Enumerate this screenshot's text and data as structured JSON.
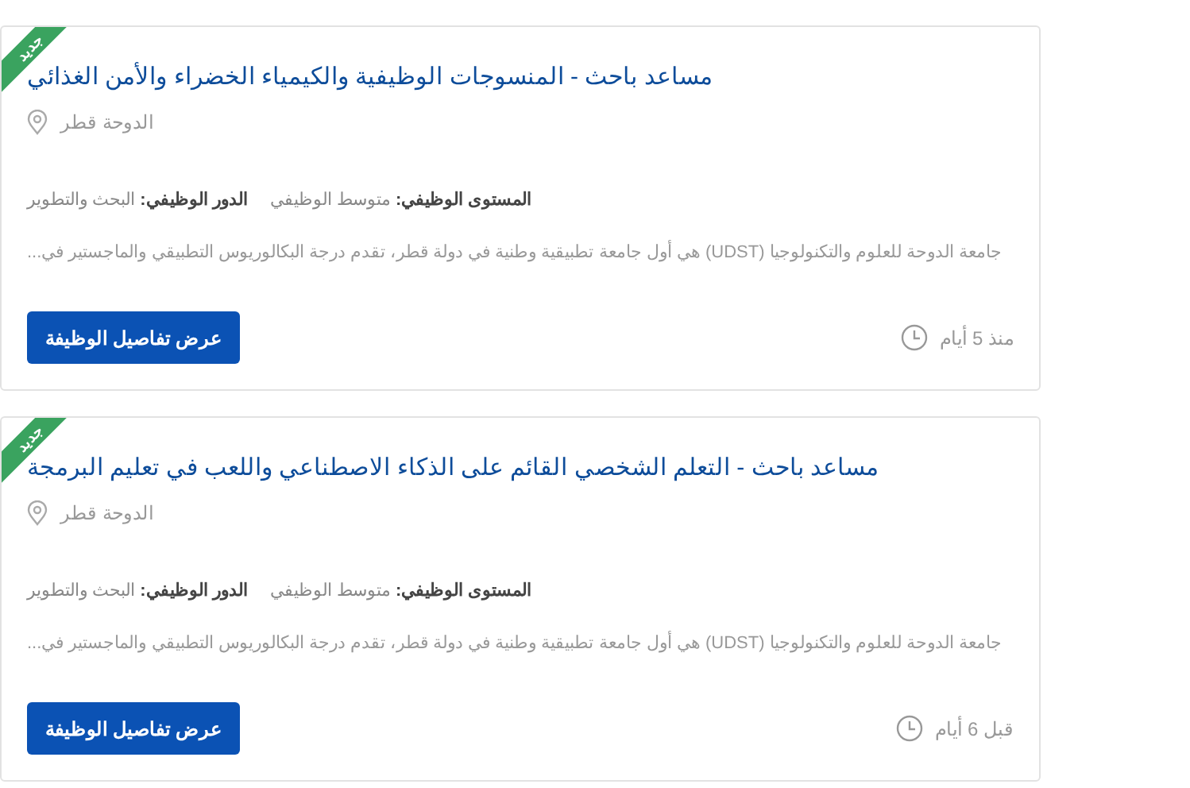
{
  "jobs": [
    {
      "badge": "جديد",
      "title": "مساعد باحث - المنسوجات الوظيفية والكيمياء الخضراء والأمن الغذائي",
      "location": "الدوحة قطر",
      "meta": [
        "**المستوى الوظيفي:** متوسط الوظيفي",
        "**الدور الوظيفي:** البحث والتطوير"
      ],
      "description": "جامعة الدوحة للعلوم والتكنولوجيا (UDST) هي أول جامعة تطبيقية وطنية في دولة قطر، تقدم درجة البكالوريوس التطبيقي والماجستير في...",
      "button": "عرض تفاصيل الوظيفة",
      "posted": "منذ 5 أيام"
    },
    {
      "badge": "جديد",
      "title": "مساعد باحث - التعلم الشخصي القائم على الذكاء الاصطناعي واللعب في تعليم البرمجة",
      "location": "الدوحة قطر",
      "meta": [
        "**المستوى الوظيفي:** متوسط الوظيفي",
        "**الدور الوظيفي:** البحث والتطوير"
      ],
      "description": "جامعة الدوحة للعلوم والتكنولوجيا (UDST) هي أول جامعة تطبيقية وطنية في دولة قطر، تقدم درجة البكالوريوس التطبيقي والماجستير في...",
      "button": "عرض تفاصيل الوظيفة",
      "posted": "قبل 6 أيام"
    }
  ]
}
